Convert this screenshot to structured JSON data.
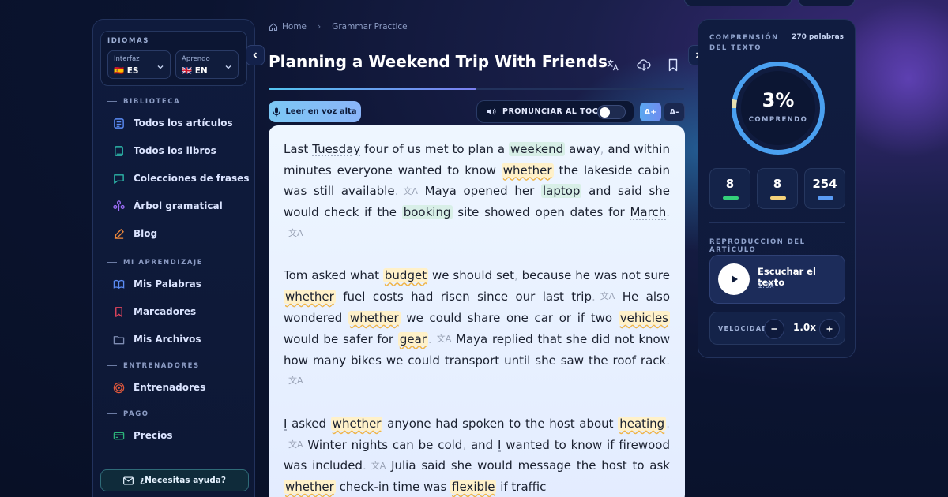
{
  "sidebar": {
    "languages": {
      "title": "IDIOMAS",
      "interface": {
        "label": "Interfaz",
        "value": "🇪🇸 ES"
      },
      "learning": {
        "label": "Aprendo",
        "value": "🇬🇧 EN"
      }
    },
    "sections": [
      {
        "label": "BIBLIOTECA",
        "items": [
          {
            "label": "Todos los artículos",
            "icon": "articles-icon"
          },
          {
            "label": "Todos los libros",
            "icon": "book-icon"
          },
          {
            "label": "Colecciones de frases",
            "icon": "chat-icon"
          },
          {
            "label": "Árbol gramatical",
            "icon": "tree-icon"
          },
          {
            "label": "Blog",
            "icon": "pencil-icon"
          }
        ]
      },
      {
        "label": "MI APRENDIZAJE",
        "items": [
          {
            "label": "Mis Palabras",
            "icon": "open-book-icon"
          },
          {
            "label": "Marcadores",
            "icon": "bookmark-icon"
          },
          {
            "label": "Mis Archivos",
            "icon": "folder-icon"
          }
        ]
      },
      {
        "label": "ENTRENADORES",
        "items": [
          {
            "label": "Entrenadores",
            "icon": "target-icon"
          }
        ]
      },
      {
        "label": "PAGO",
        "items": [
          {
            "label": "Precios",
            "icon": "card-icon"
          }
        ]
      }
    ],
    "help_label": "¿Necesitas ayuda?"
  },
  "breadcrumb": {
    "home": "Home",
    "current": "Grammar Practice"
  },
  "article": {
    "title": "Planning a Weekend Trip With Friends",
    "progress": 0.5,
    "read_aloud_label": "Leer en voz alta",
    "pronounce_label": "PRONUNCIAR AL TOCAR",
    "pronounce_on": false,
    "font_up": "A+",
    "font_down": "A-"
  },
  "stats": {
    "comprehension_label": "COMPRENSIÓN DEL TEXTO",
    "words": "270 palabras",
    "percent": "3%",
    "percent_value": 3,
    "percent_label": "COMPRENDO",
    "counts": [
      {
        "value": "8",
        "color": "#34d07a"
      },
      {
        "value": "8",
        "color": "#f5d27a"
      },
      {
        "value": "254",
        "color": "#5a9cf5"
      }
    ]
  },
  "playback": {
    "label": "REPRODUCCIÓN DEL ARTÍCULO",
    "title": "Escuchar el texto",
    "speed_small": "1.0x",
    "speed_label": "VELOCIDAD",
    "speed_value": "1.0x"
  }
}
